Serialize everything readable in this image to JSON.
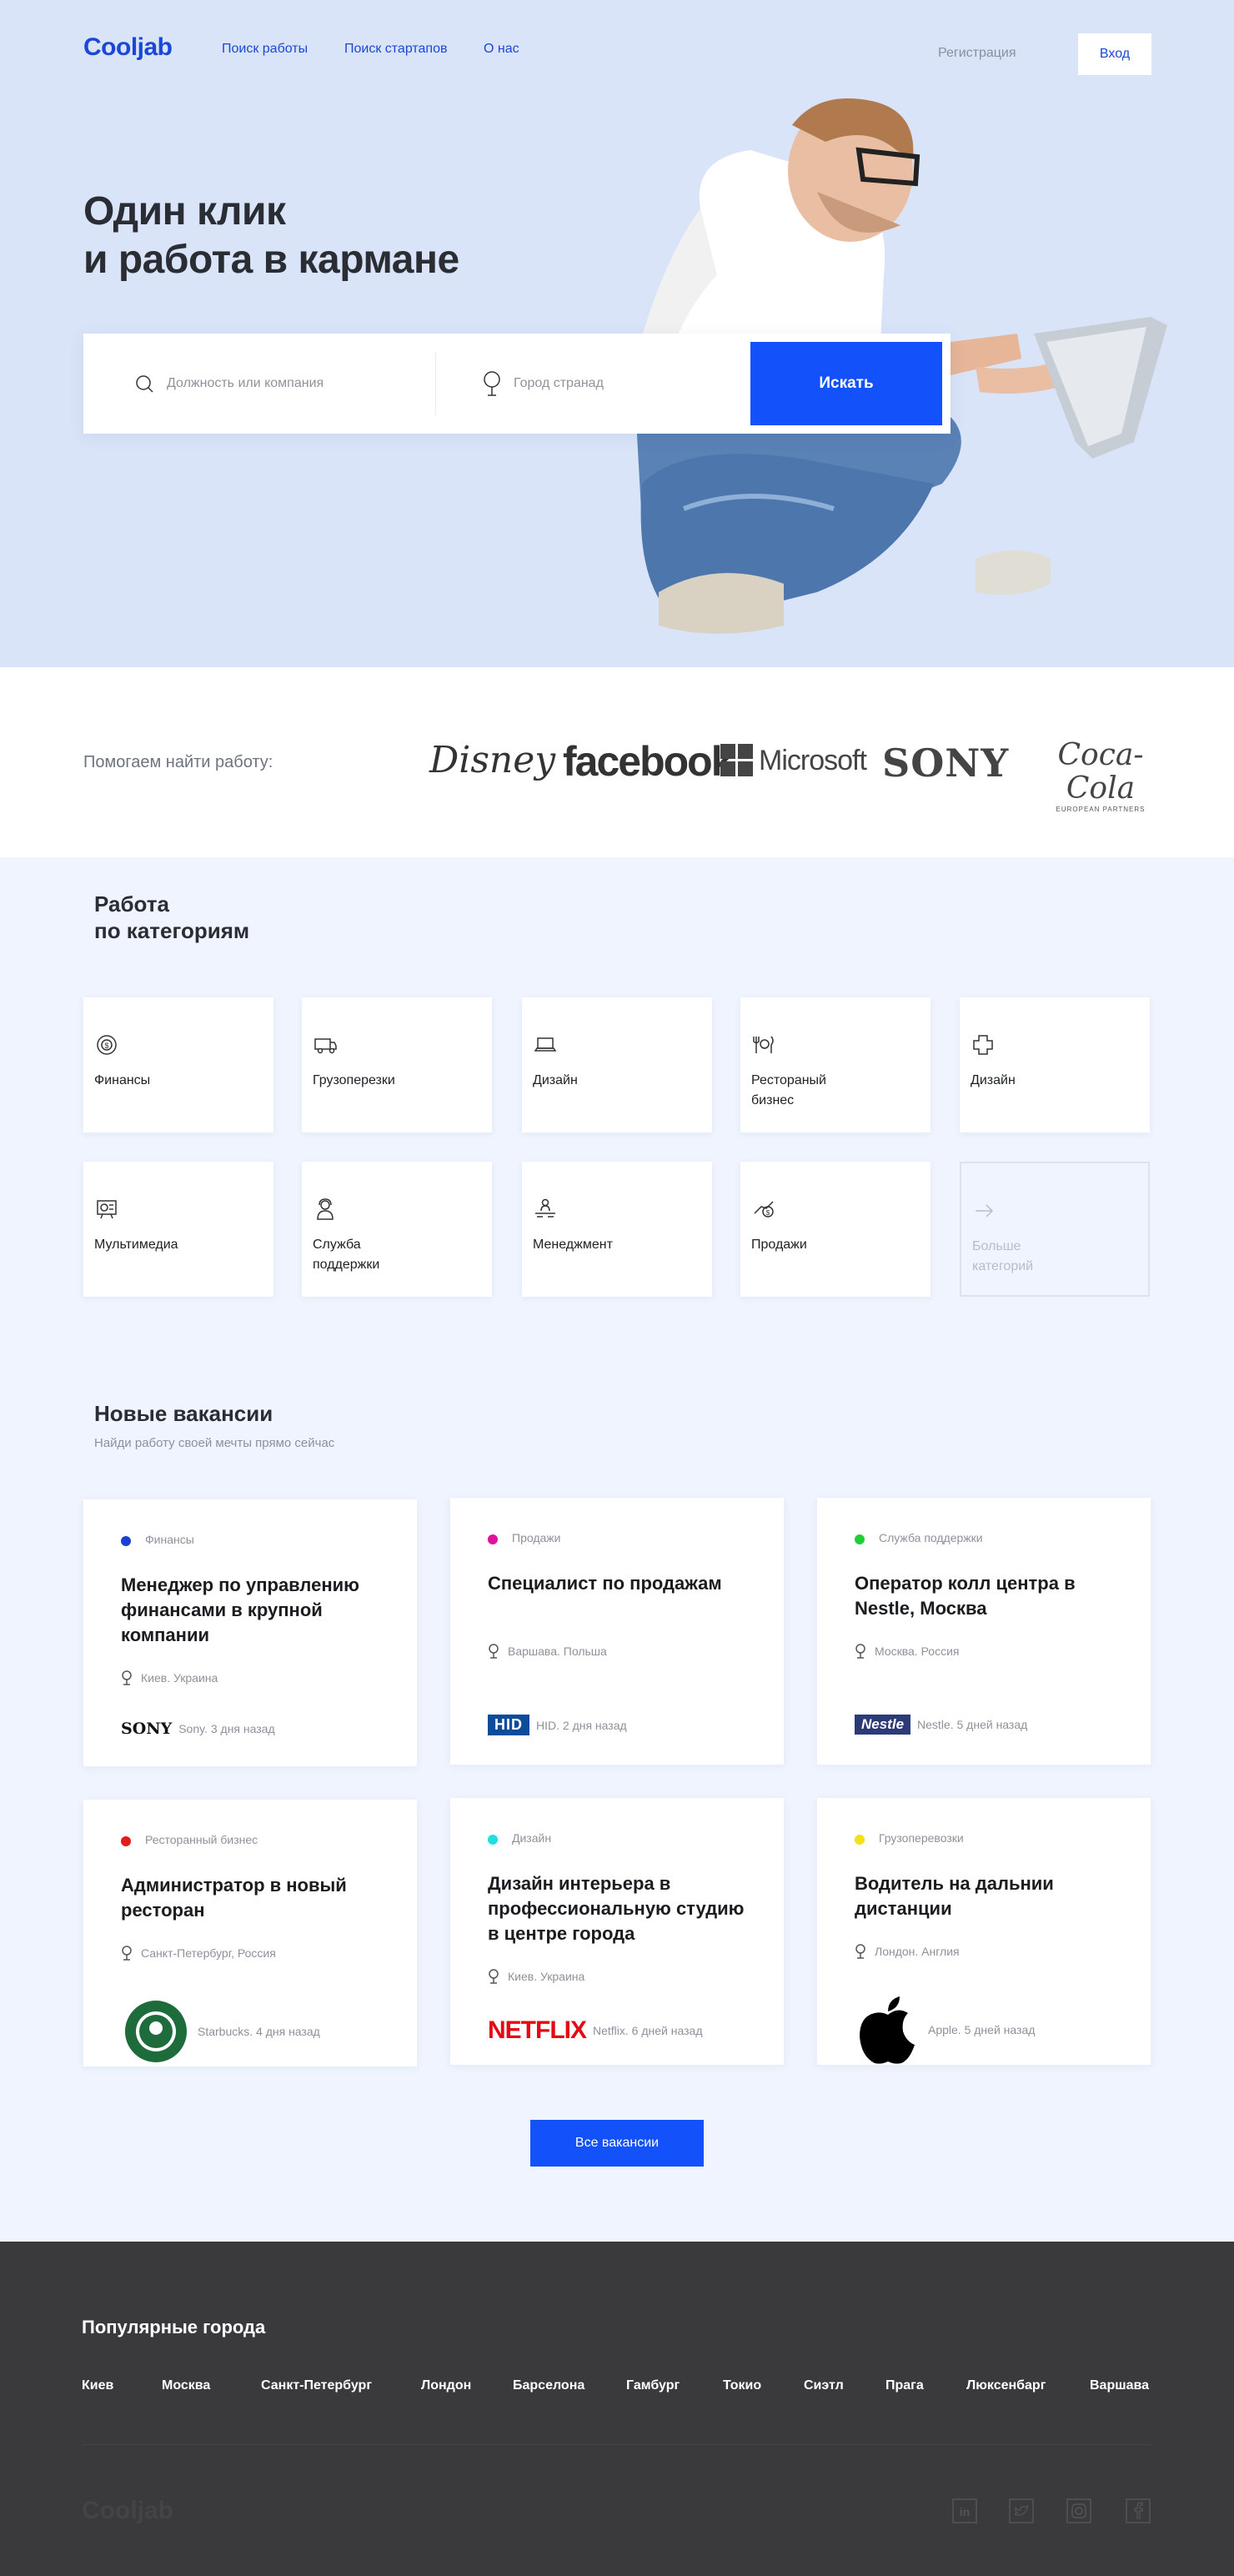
{
  "nav": {
    "logo": "Cooljab",
    "links": [
      "Поиск работы",
      "Поиск стартапов",
      "О нас"
    ],
    "register": "Регистрация",
    "login": "Вход"
  },
  "hero": {
    "title_line1": "Один клик",
    "title_line2": "и работа в кармане",
    "search": {
      "position_placeholder": "Должность или компания",
      "city_placeholder": "Город странад",
      "button": "Искать"
    }
  },
  "partners": {
    "label": "Помогаем найти работу:",
    "brands": [
      "Disney",
      "facebook",
      "Microsoft",
      "SONY",
      "Coca-Cola"
    ],
    "coca_sub": "EUROPEAN PARTNERS"
  },
  "categories": {
    "title_line1": "Работа",
    "title_line2": "по категориям",
    "items": [
      {
        "label": "Финансы",
        "icon": "finance-icon"
      },
      {
        "label": "Грузоперезки",
        "icon": "truck-icon"
      },
      {
        "label": "Дизайн",
        "icon": "laptop-icon"
      },
      {
        "label": "Ресторaный\nбизнес",
        "icon": "restaurant-icon"
      },
      {
        "label": "Дизайн",
        "icon": "puzzle-icon"
      },
      {
        "label": "Мультимедиа",
        "icon": "multimedia-icon"
      },
      {
        "label": "Служба\nподдержки",
        "icon": "support-icon"
      },
      {
        "label": "Менеджмент",
        "icon": "management-icon"
      },
      {
        "label": "Продажи",
        "icon": "sales-icon"
      },
      {
        "label": "Больше\nкатегорий",
        "icon": "arrow-right-icon"
      }
    ]
  },
  "vacancies": {
    "title": "Новые вакансии",
    "subtitle": "Найди работу своей мечты прямо сейчас",
    "items": [
      {
        "category": "Финансы",
        "dot": "#1a3fd1",
        "title": "Менеджер по управлению финансами в крупной компании",
        "location": "Киев. Украина",
        "company": "Sony. 3 дня назад",
        "logo": "SONY"
      },
      {
        "category": "Продажи",
        "dot": "#e0119a",
        "title": "Специалист по продажам",
        "location": "Варшава. Польша",
        "company": "HID. 2 дня назад",
        "logo": "HID"
      },
      {
        "category": "Служба поддержки",
        "dot": "#1ecf3a",
        "title": "Оператор колл центра в Nestle, Москва",
        "location": "Москва. Россия",
        "company": "Nestle. 5 дней назад",
        "logo": "Nestle"
      },
      {
        "category": "Ресторанный бизнес",
        "dot": "#e21a1a",
        "title": "Администратор в новый ресторан",
        "location": "Санкт-Петербург, Россия",
        "company": "Starbucks. 4 дня назад",
        "logo": "STARBUCKS COFFEE"
      },
      {
        "category": "Дизайн",
        "dot": "#1ee0e0",
        "title": "Дизайн интерьера в профессиональную студию в центре города",
        "location": "Киев. Украина",
        "company": "Netflix. 6 дней назад",
        "logo": "NETFLIX"
      },
      {
        "category": "Грузоперевозки",
        "dot": "#f5e010",
        "title": "Водитель на дальнии дистанции",
        "location": "Лондон. Англия",
        "company": "Apple. 5 дней назад",
        "logo": "apple"
      }
    ],
    "all_button": "Все вакансии"
  },
  "footer": {
    "title": "Популярные города",
    "cities": [
      "Киев",
      "Москва",
      "Санкт-Петербург",
      "Лондон",
      "Барселона",
      "Гамбург",
      "Токио",
      "Сиэтл",
      "Прага",
      "Люксенбарг",
      "Варшава"
    ],
    "logo": "Cooljab",
    "social": [
      "linkedin-icon",
      "twitter-icon",
      "instagram-icon",
      "facebook-icon"
    ]
  }
}
